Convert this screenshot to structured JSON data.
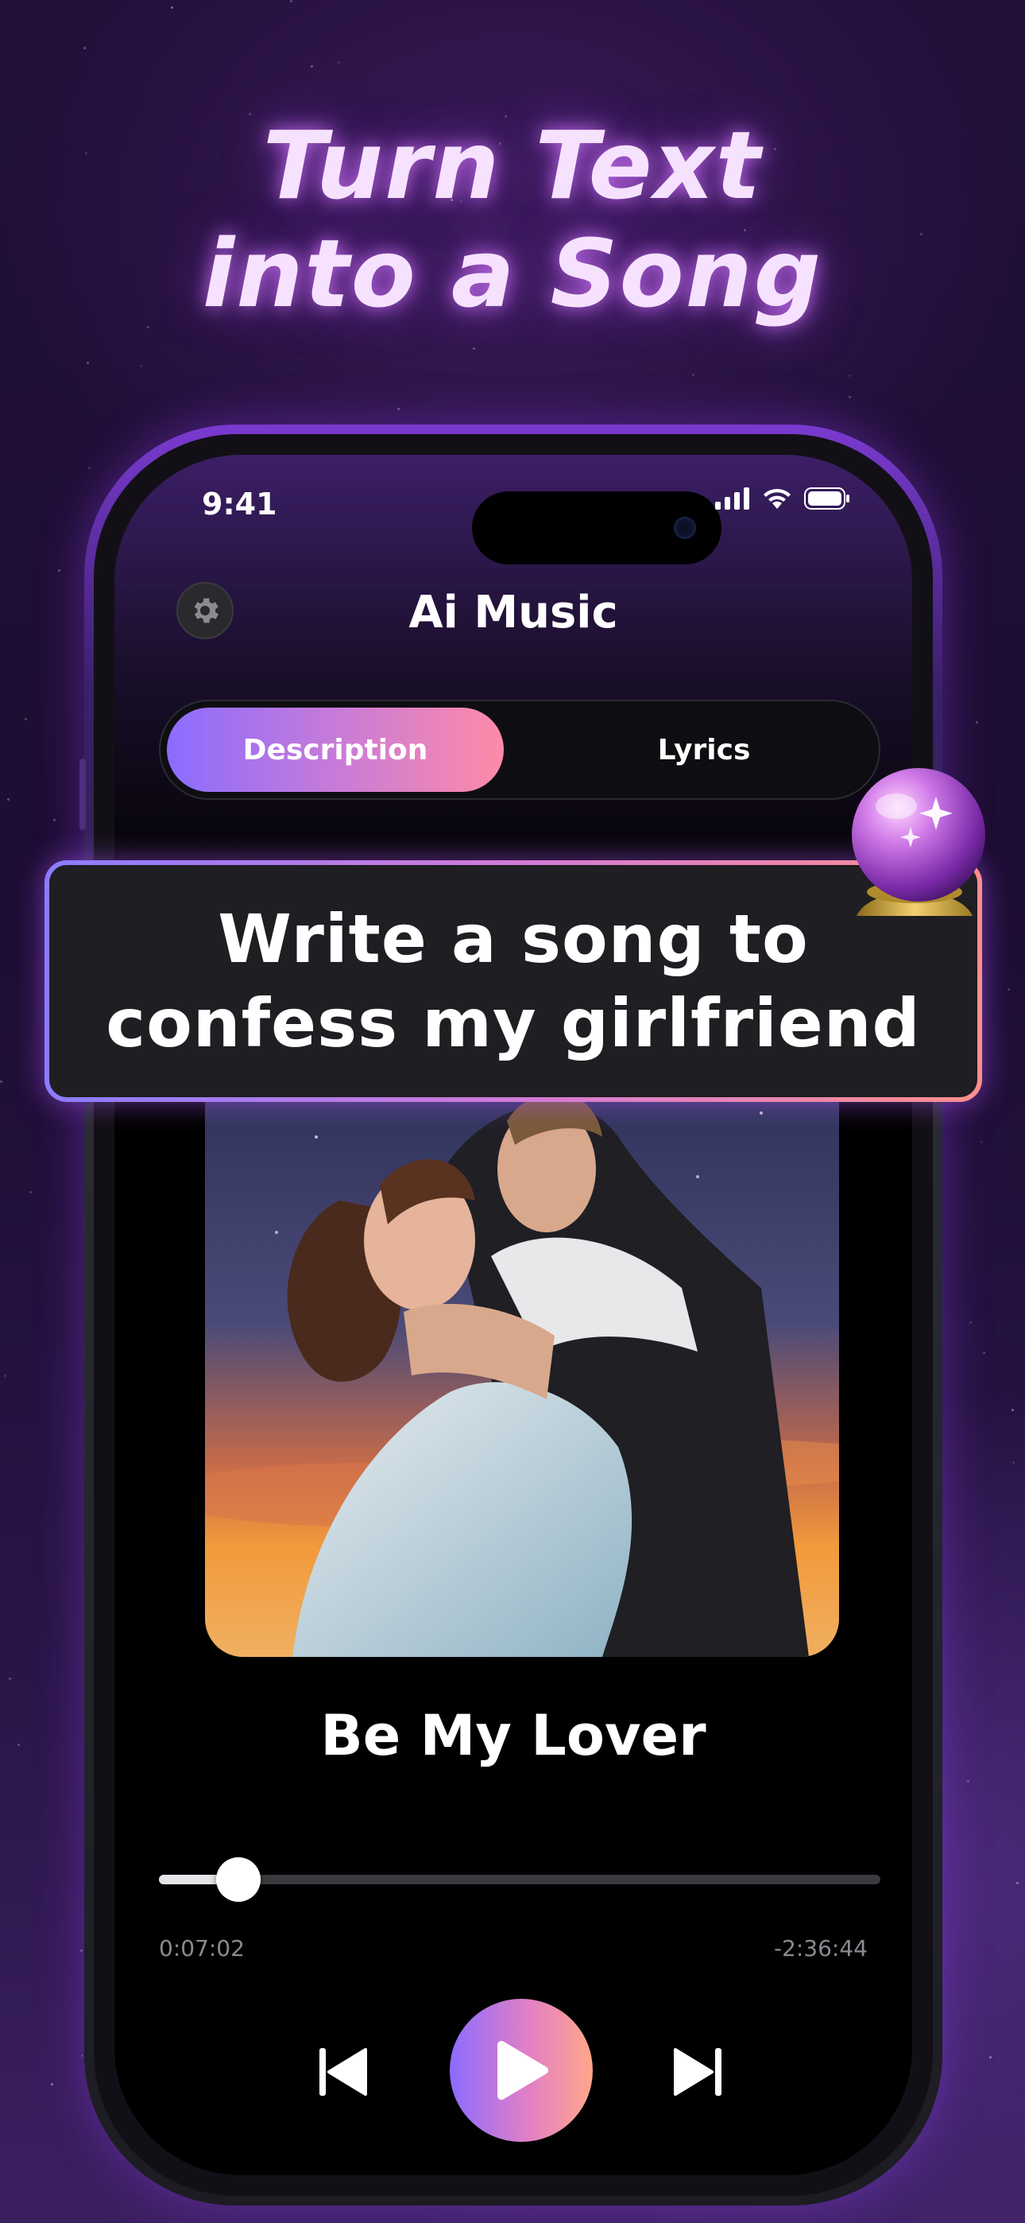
{
  "headline": {
    "line1": "Turn Text",
    "line2": "into a Song"
  },
  "status_bar": {
    "time": "9:41",
    "icons": [
      "cellular-signal-icon",
      "wifi-icon",
      "battery-icon"
    ]
  },
  "app": {
    "title": "Ai Music",
    "settings_icon": "gear-icon"
  },
  "tabs": [
    {
      "label": "Description",
      "active": true
    },
    {
      "label": "Lyrics",
      "active": false
    }
  ],
  "prompt": {
    "line1": "Write a song to",
    "line2": "confess my girlfriend",
    "decoration_icon": "crystal-ball-icon"
  },
  "player": {
    "artwork": "couple-embracing-sunset-artwork",
    "song_title": "Be My Lover",
    "elapsed": "0:07:02",
    "remaining": "-2:36:44",
    "progress_fraction": 0.11,
    "controls": [
      "skip-back-icon",
      "play-icon",
      "skip-forward-icon"
    ]
  },
  "colors": {
    "accent_gradient_start": "#8b6cff",
    "accent_gradient_end": "#ff8aa8",
    "headline_glow": "#d678ff",
    "background": "#1d0d33"
  }
}
